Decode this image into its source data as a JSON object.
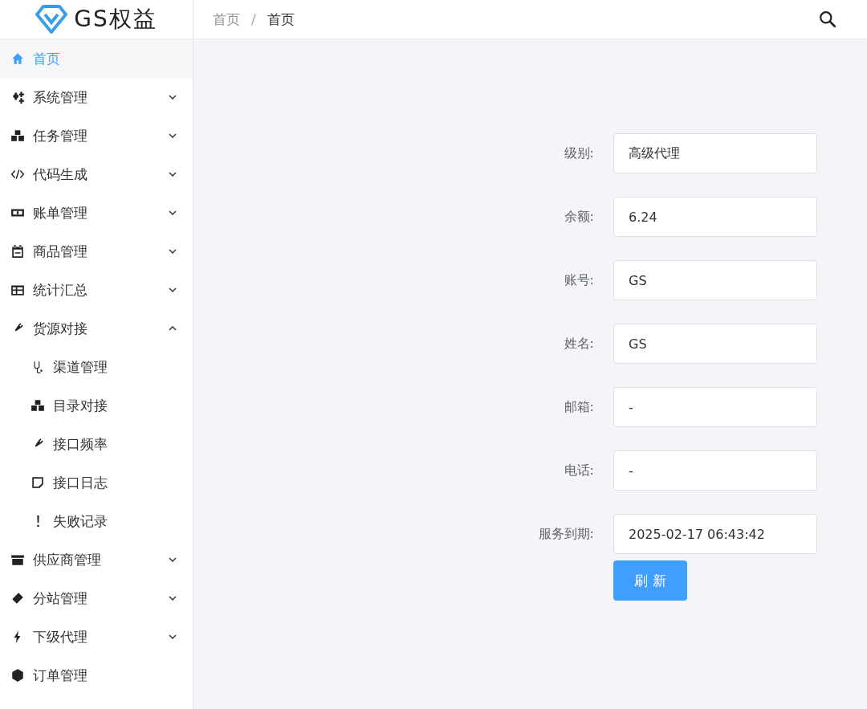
{
  "logo": {
    "text": "GS权益"
  },
  "breadcrumb_separator": "/",
  "breadcrumb": [
    {
      "label": "首页",
      "selected": false
    },
    {
      "label": "首页",
      "selected": true
    }
  ],
  "sidebar": {
    "items": [
      {
        "label": "首页",
        "selected": true
      },
      {
        "label": "系统管理",
        "selected": false,
        "expanded": false
      },
      {
        "label": "任务管理",
        "selected": false,
        "expanded": false
      },
      {
        "label": "代码生成",
        "selected": false,
        "expanded": false
      },
      {
        "label": "账单管理",
        "selected": false,
        "expanded": false
      },
      {
        "label": "商品管理",
        "selected": false,
        "expanded": false
      },
      {
        "label": "统计汇总",
        "selected": false,
        "expanded": false
      },
      {
        "label": "货源对接",
        "selected": false,
        "expanded": true,
        "children": [
          {
            "label": "渠道管理",
            "selected": false
          },
          {
            "label": "目录对接",
            "selected": false
          },
          {
            "label": "接口频率",
            "selected": false
          },
          {
            "label": "接口日志",
            "selected": false
          },
          {
            "label": "失败记录",
            "selected": false
          }
        ]
      },
      {
        "label": "供应商管理",
        "selected": false,
        "expanded": false
      },
      {
        "label": "分站管理",
        "selected": false,
        "expanded": false
      },
      {
        "label": "下级代理",
        "selected": false,
        "expanded": false
      },
      {
        "label": "订单管理",
        "selected": false
      }
    ]
  },
  "form": {
    "fields": [
      {
        "label": "级别:",
        "value": "高级代理"
      },
      {
        "label": "余额:",
        "value": "6.24"
      },
      {
        "label": "账号:",
        "value": "GS"
      },
      {
        "label": "姓名:",
        "value": "GS"
      },
      {
        "label": "邮箱:",
        "value": "-"
      },
      {
        "label": "电话:",
        "value": "-"
      },
      {
        "label": "服务到期:",
        "value": "2025-02-17 06:43:42"
      }
    ],
    "button": "刷 新"
  }
}
